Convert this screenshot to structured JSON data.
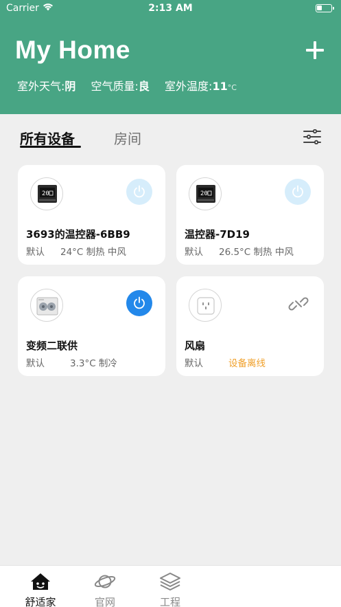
{
  "status_bar": {
    "carrier": "Carrier",
    "time": "2:13 AM"
  },
  "header": {
    "title": "My Home",
    "weather": {
      "label": "室外天气:",
      "value": "阴"
    },
    "air_quality": {
      "label": "空气质量:",
      "value": "良"
    },
    "temperature": {
      "label": "室外温度:",
      "value": "11",
      "unit": "°C"
    }
  },
  "tabs": {
    "all_devices": "所有设备",
    "rooms": "房间"
  },
  "devices": [
    {
      "name": "3693的温控器-6BB9",
      "room": "默认",
      "status": "24°C 制热 中风",
      "power": "off",
      "icon": "thermostat-image"
    },
    {
      "name": "温控器-7D19",
      "room": "默认",
      "status": "26.5°C 制热 中风",
      "power": "off",
      "icon": "thermostat-image"
    },
    {
      "name": "变频二联供",
      "room": "默认",
      "status": "3.3°C 制冷",
      "power": "on",
      "icon": "heat-pump-image"
    },
    {
      "name": "风扇",
      "room": "默认",
      "status": "设备离线",
      "power": "offline",
      "icon": "smart-plug-image"
    }
  ],
  "tabbar": {
    "home": "舒适家",
    "official": "官网",
    "engineering": "工程"
  },
  "colors": {
    "header": "#48a584",
    "power_on": "#2388ea",
    "power_off": "#d6edfb",
    "offline": "#f0a02a"
  }
}
